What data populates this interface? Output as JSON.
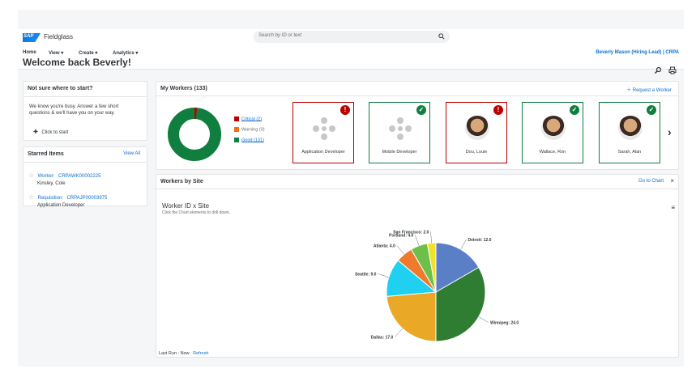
{
  "app": {
    "logo": "SAP",
    "product": "Fieldglass",
    "search_placeholder": "Search by ID or text",
    "user": "Beverly Mason (Hiring Lead) | CRPA"
  },
  "nav": [
    {
      "label": "Home"
    },
    {
      "label": "View"
    },
    {
      "label": "Create"
    },
    {
      "label": "Analytics"
    }
  ],
  "page": {
    "welcome": "Welcome back Beverly!"
  },
  "start_panel": {
    "title": "Not sure where to start?",
    "body": "We know you're busy. Answer a few short questions & we'll have you on your way.",
    "cta": "Click to start"
  },
  "starred": {
    "title": "Starred Items",
    "view_all": "View All",
    "items": [
      {
        "type": "Worker:",
        "id": "CRPAWK00002225",
        "sub": "Kinsley, Cole"
      },
      {
        "type": "Requisition:",
        "id": "CRPAJP00003975",
        "sub": "Application Developer"
      }
    ]
  },
  "workers": {
    "title": "My Workers (133)",
    "request": "Request a Worker",
    "legend": [
      {
        "label": "Critical (2)",
        "color": "#bb0000"
      },
      {
        "label": "Warning (0)",
        "color": "#e9730c"
      },
      {
        "label": "Good (131)",
        "color": "#107e3e"
      }
    ],
    "donut": {
      "critical": 2,
      "warning": 0,
      "good": 131
    },
    "cards": [
      {
        "label": "Application Developer",
        "status": "red",
        "photo": false
      },
      {
        "label": "Mobile Developer",
        "status": "green",
        "photo": false
      },
      {
        "label": "Dou, Louie",
        "status": "red",
        "photo": true
      },
      {
        "label": "Wallace, Ron",
        "status": "green",
        "photo": true
      },
      {
        "label": "Sarah, Alan",
        "status": "green",
        "photo": true
      }
    ]
  },
  "site": {
    "title": "Workers by Site",
    "goto": "Go to Chart",
    "chart_title": "Worker ID x Site",
    "hint": "Click the Chart elements to drill down.",
    "last_run_label": "Last Run : Now",
    "refresh": "Refresh"
  },
  "chart_data": {
    "type": "pie",
    "title": "Worker ID x Site",
    "slices": [
      {
        "name": "Detroit",
        "value": 12.0,
        "label": "Detroit: 12.0",
        "color": "#5b7fc7"
      },
      {
        "name": "Winnipeg",
        "value": 24.0,
        "label": "Winnipeg: 24.0",
        "color": "#2e7d32"
      },
      {
        "name": "Dallas",
        "value": 17.0,
        "label": "Dallas: 17.0",
        "color": "#e9a825"
      },
      {
        "name": "Seattle",
        "value": 9.0,
        "label": "Seattle: 9.0",
        "color": "#1fd0f0"
      },
      {
        "name": "Atlanta",
        "value": 4.0,
        "label": "Atlanta: 4.0",
        "color": "#ef7a2d"
      },
      {
        "name": "Portland",
        "value": 4.0,
        "label": "Portland: 4.0",
        "color": "#6cc04a"
      },
      {
        "name": "San Francisco",
        "value": 2.0,
        "label": "San Francisco: 2.0",
        "color": "#f1e12a"
      }
    ]
  }
}
